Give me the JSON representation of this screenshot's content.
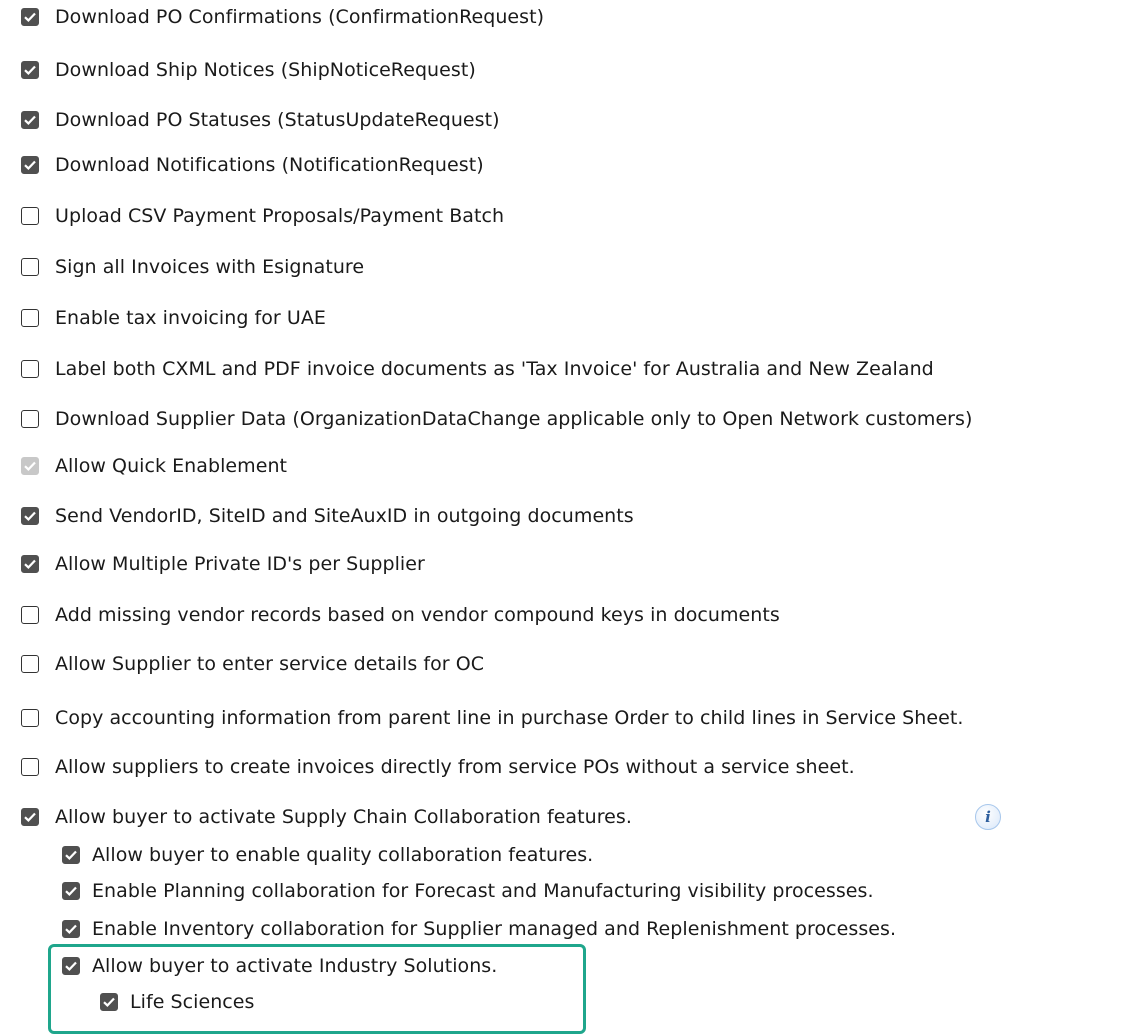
{
  "options": [
    {
      "label": "Download PO Confirmations (ConfirmationRequest)",
      "state": "checked"
    },
    {
      "label": "Download Ship Notices (ShipNoticeRequest)",
      "state": "checked"
    },
    {
      "label": "Download PO Statuses (StatusUpdateRequest)",
      "state": "checked"
    },
    {
      "label": "Download Notifications (NotificationRequest)",
      "state": "checked"
    },
    {
      "label": "Upload CSV Payment Proposals/Payment Batch",
      "state": "unchecked"
    },
    {
      "label": "Sign all Invoices with Esignature",
      "state": "unchecked"
    },
    {
      "label": "Enable tax invoicing for UAE",
      "state": "unchecked"
    },
    {
      "label": "Label both CXML and PDF invoice documents as 'Tax Invoice' for Australia and New Zealand",
      "state": "unchecked"
    },
    {
      "label": "Download Supplier Data (OrganizationDataChange applicable only to Open Network customers)",
      "state": "unchecked"
    },
    {
      "label": "Allow Quick Enablement",
      "state": "disabled-checked"
    },
    {
      "label": "Send VendorID, SiteID and SiteAuxID in outgoing documents",
      "state": "checked"
    },
    {
      "label": "Allow Multiple Private ID's per Supplier",
      "state": "checked"
    },
    {
      "label": "Add missing vendor records based on vendor compound keys in documents",
      "state": "unchecked"
    },
    {
      "label": "Allow Supplier to enter service details for OC",
      "state": "unchecked"
    },
    {
      "label": "Copy accounting information from parent line in purchase Order to child lines in Service Sheet.",
      "state": "unchecked"
    },
    {
      "label": "Allow suppliers to create invoices directly from service POs without a service sheet.",
      "state": "unchecked"
    },
    {
      "label": "Allow buyer to activate Supply Chain Collaboration features.",
      "state": "checked"
    }
  ],
  "info_icon": {
    "name": "info-icon",
    "glyph": "i"
  },
  "sub_options": [
    {
      "label": "Allow buyer to enable quality collaboration features.",
      "state": "checked"
    },
    {
      "label": "Enable Planning collaboration for Forecast and Manufacturing visibility processes.",
      "state": "checked"
    },
    {
      "label": "Enable Inventory collaboration for Supplier managed and Replenishment processes.",
      "state": "checked"
    },
    {
      "label": "Allow buyer to activate Industry Solutions.",
      "state": "checked"
    }
  ],
  "sub_sub_options": [
    {
      "label": "Life Sciences",
      "state": "checked"
    }
  ],
  "colors": {
    "checkbox_checked": "#505050",
    "checkbox_disabled": "#c8c8c8",
    "highlight_border": "#1fa68c",
    "info_icon_text": "#2f5f9e"
  }
}
